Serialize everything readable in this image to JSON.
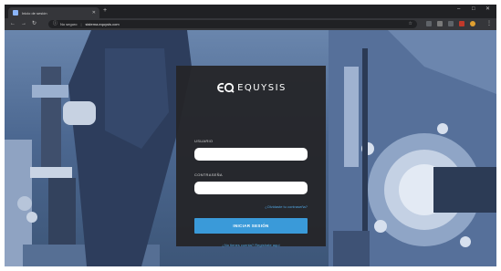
{
  "browser": {
    "tab_title": "Inicio de sesión",
    "new_tab": "+",
    "security_label": "No seguro",
    "url": "sistema.equysis.com"
  },
  "login": {
    "brand": "EQUYSIS",
    "user_label": "USUARIO",
    "password_label": "CONTRASEÑA",
    "user_value": "",
    "password_value": "",
    "forgot_link": "¿Olvidaste tu contraseña?",
    "submit_label": "INICIAR SESIÓN",
    "register_text": "¿No tienes cuenta? Regístrate aquí"
  },
  "colors": {
    "accent": "#3a9ad9",
    "link": "#4fa3df",
    "card": "#252528"
  },
  "icons": {
    "back": "arrow-left-icon",
    "forward": "arrow-right-icon",
    "reload": "reload-icon",
    "lock": "info-icon",
    "star": "star-icon",
    "menu": "kebab-menu-icon"
  }
}
